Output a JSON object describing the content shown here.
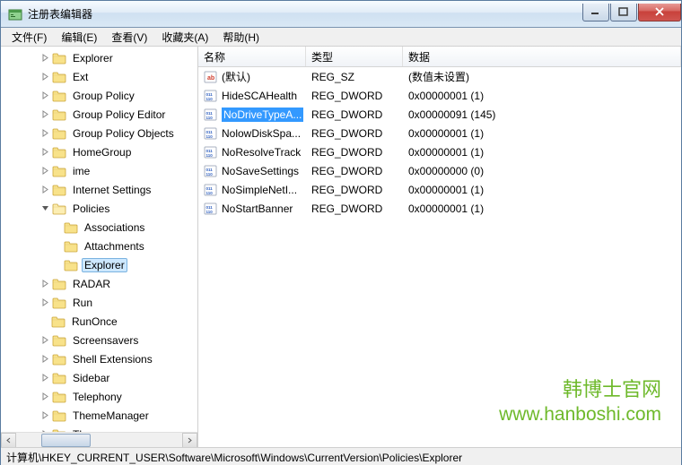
{
  "window": {
    "title": "注册表编辑器"
  },
  "menu": {
    "file": "文件(F)",
    "edit": "编辑(E)",
    "view": "查看(V)",
    "favorites": "收藏夹(A)",
    "help": "帮助(H)"
  },
  "tree": {
    "items": [
      {
        "indent": 3,
        "expand": "closed",
        "label": "Explorer"
      },
      {
        "indent": 3,
        "expand": "closed",
        "label": "Ext"
      },
      {
        "indent": 3,
        "expand": "closed",
        "label": "Group Policy"
      },
      {
        "indent": 3,
        "expand": "closed",
        "label": "Group Policy Editor"
      },
      {
        "indent": 3,
        "expand": "closed",
        "label": "Group Policy Objects"
      },
      {
        "indent": 3,
        "expand": "closed",
        "label": "HomeGroup"
      },
      {
        "indent": 3,
        "expand": "closed",
        "label": "ime"
      },
      {
        "indent": 3,
        "expand": "closed",
        "label": "Internet Settings"
      },
      {
        "indent": 3,
        "expand": "open",
        "label": "Policies"
      },
      {
        "indent": 4,
        "expand": "none",
        "label": "Associations"
      },
      {
        "indent": 4,
        "expand": "none",
        "label": "Attachments"
      },
      {
        "indent": 4,
        "expand": "none",
        "label": "Explorer",
        "selected": true
      },
      {
        "indent": 3,
        "expand": "closed",
        "label": "RADAR"
      },
      {
        "indent": 3,
        "expand": "closed",
        "label": "Run"
      },
      {
        "indent": 3,
        "expand": "none",
        "label": "RunOnce"
      },
      {
        "indent": 3,
        "expand": "closed",
        "label": "Screensavers"
      },
      {
        "indent": 3,
        "expand": "closed",
        "label": "Shell Extensions"
      },
      {
        "indent": 3,
        "expand": "closed",
        "label": "Sidebar"
      },
      {
        "indent": 3,
        "expand": "closed",
        "label": "Telephony"
      },
      {
        "indent": 3,
        "expand": "closed",
        "label": "ThemeManager"
      },
      {
        "indent": 3,
        "expand": "closed",
        "label": "Themes"
      }
    ]
  },
  "list": {
    "headers": {
      "name": "名称",
      "type": "类型",
      "data": "数据"
    },
    "rows": [
      {
        "icon": "sz",
        "name": "(默认)",
        "type": "REG_SZ",
        "data": "(数值未设置)"
      },
      {
        "icon": "dw",
        "name": "HideSCAHealth",
        "type": "REG_DWORD",
        "data": "0x00000001 (1)"
      },
      {
        "icon": "dw",
        "name": "NoDriveTypeA...",
        "type": "REG_DWORD",
        "data": "0x00000091 (145)",
        "selected": true
      },
      {
        "icon": "dw",
        "name": "NolowDiskSpa...",
        "type": "REG_DWORD",
        "data": "0x00000001 (1)"
      },
      {
        "icon": "dw",
        "name": "NoResolveTrack",
        "type": "REG_DWORD",
        "data": "0x00000001 (1)"
      },
      {
        "icon": "dw",
        "name": "NoSaveSettings",
        "type": "REG_DWORD",
        "data": "0x00000000 (0)"
      },
      {
        "icon": "dw",
        "name": "NoSimpleNetI...",
        "type": "REG_DWORD",
        "data": "0x00000001 (1)"
      },
      {
        "icon": "dw",
        "name": "NoStartBanner",
        "type": "REG_DWORD",
        "data": "0x00000001 (1)"
      }
    ]
  },
  "watermark": {
    "cn": "韩博士官网",
    "url": "www.hanboshi.com"
  },
  "statusbar": {
    "path": "计算机\\HKEY_CURRENT_USER\\Software\\Microsoft\\Windows\\CurrentVersion\\Policies\\Explorer"
  }
}
